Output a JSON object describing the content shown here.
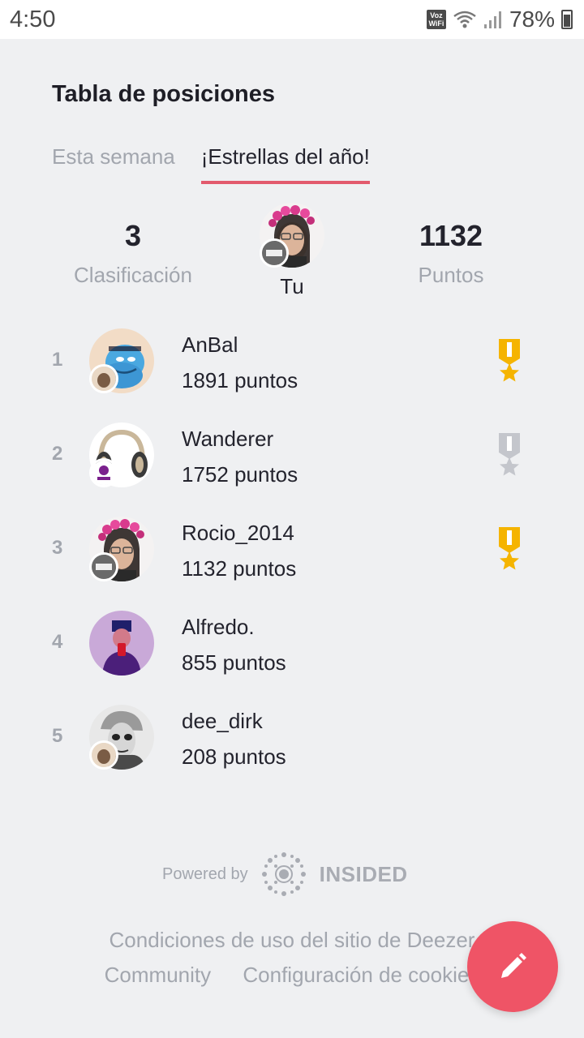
{
  "status_bar": {
    "time": "4:50",
    "voz_top": "Voz",
    "voz_bottom": "WiFi",
    "battery": "78%"
  },
  "page": {
    "title": "Tabla de posiciones",
    "tabs": [
      {
        "label": "Esta semana",
        "active": false
      },
      {
        "label": "¡Estrellas del año!",
        "active": true
      }
    ]
  },
  "summary": {
    "rank_value": "3",
    "rank_label": "Clasificación",
    "me_label": "Tu",
    "points_value": "1132",
    "points_label": "Puntos"
  },
  "leaderboard": [
    {
      "rank": "1",
      "name": "AnBal",
      "points": "1891 puntos",
      "medal": "gold-medal-icon"
    },
    {
      "rank": "2",
      "name": "Wanderer",
      "points": "1752 puntos",
      "medal": "silver-medal-icon"
    },
    {
      "rank": "3",
      "name": "Rocio_2014",
      "points": "1132 puntos",
      "medal": "bronze-medal-icon"
    },
    {
      "rank": "4",
      "name": "Alfredo.",
      "points": "855 puntos",
      "medal": null
    },
    {
      "rank": "5",
      "name": "dee_dirk",
      "points": "208 puntos",
      "medal": null
    }
  ],
  "footer": {
    "powered_by": "Powered by",
    "brand": "INSIDED",
    "link1": "Condiciones de uso del sitio de Deezer",
    "link2": "Community",
    "link3": "Configuración de cookies"
  },
  "colors": {
    "accent": "#e25a6d",
    "fab": "#ef5466",
    "gold": "#f5b400",
    "silver": "#c4c6cc"
  }
}
